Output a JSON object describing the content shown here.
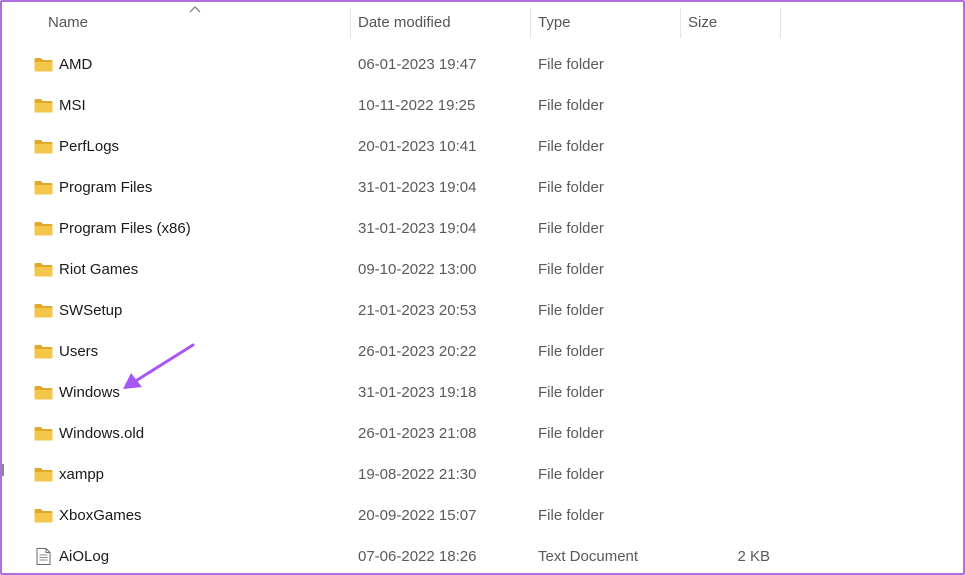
{
  "columns": {
    "name": "Name",
    "date": "Date modified",
    "type": "Type",
    "size": "Size"
  },
  "sort": {
    "column": "name",
    "direction": "ascending"
  },
  "files": [
    {
      "name": "AMD",
      "date": "06-01-2023 19:47",
      "type": "File folder",
      "size": "",
      "icon": "folder-icon"
    },
    {
      "name": "MSI",
      "date": "10-11-2022 19:25",
      "type": "File folder",
      "size": "",
      "icon": "folder-icon"
    },
    {
      "name": "PerfLogs",
      "date": "20-01-2023 10:41",
      "type": "File folder",
      "size": "",
      "icon": "folder-icon"
    },
    {
      "name": "Program Files",
      "date": "31-01-2023 19:04",
      "type": "File folder",
      "size": "",
      "icon": "folder-icon"
    },
    {
      "name": "Program Files (x86)",
      "date": "31-01-2023 19:04",
      "type": "File folder",
      "size": "",
      "icon": "folder-icon"
    },
    {
      "name": "Riot Games",
      "date": "09-10-2022 13:00",
      "type": "File folder",
      "size": "",
      "icon": "folder-icon"
    },
    {
      "name": "SWSetup",
      "date": "21-01-2023 20:53",
      "type": "File folder",
      "size": "",
      "icon": "folder-icon"
    },
    {
      "name": "Users",
      "date": "26-01-2023 20:22",
      "type": "File folder",
      "size": "",
      "icon": "folder-icon"
    },
    {
      "name": "Windows",
      "date": "31-01-2023 19:18",
      "type": "File folder",
      "size": "",
      "icon": "folder-icon"
    },
    {
      "name": "Windows.old",
      "date": "26-01-2023 21:08",
      "type": "File folder",
      "size": "",
      "icon": "folder-icon"
    },
    {
      "name": "xampp",
      "date": "19-08-2022 21:30",
      "type": "File folder",
      "size": "",
      "icon": "folder-icon"
    },
    {
      "name": "XboxGames",
      "date": "20-09-2022 15:07",
      "type": "File folder",
      "size": "",
      "icon": "folder-icon"
    },
    {
      "name": "AiOLog",
      "date": "07-06-2022 18:26",
      "type": "Text Document",
      "size": "2 KB",
      "icon": "text-document-icon"
    }
  ],
  "annotation": {
    "target": "Windows",
    "color": "#a855f7"
  },
  "colors": {
    "frame": "#b06ee0",
    "folder": "#f4c64a",
    "folder_dark": "#e0a92a"
  }
}
